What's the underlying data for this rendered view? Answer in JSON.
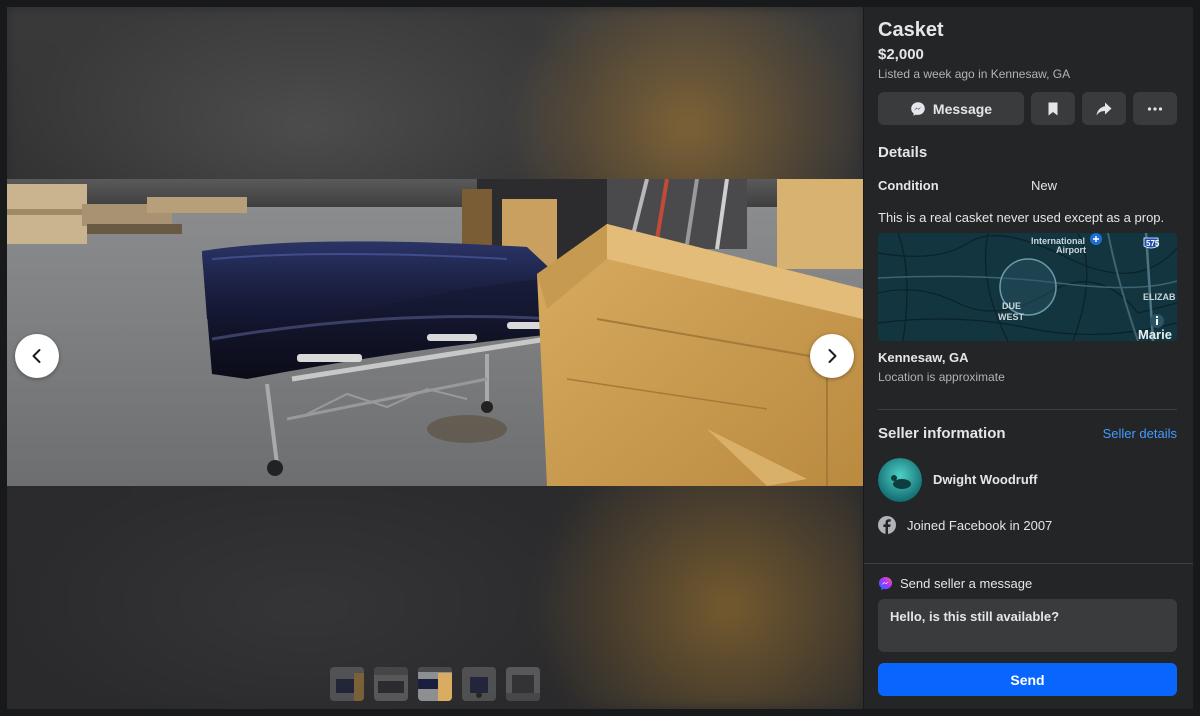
{
  "listing": {
    "title": "Casket",
    "price": "$2,000",
    "listed": "Listed a week ago in Kennesaw, GA"
  },
  "actions": {
    "message_label": "Message",
    "save_icon": "bookmark-icon",
    "share_icon": "share-icon",
    "more_icon": "more-icon"
  },
  "details": {
    "heading": "Details",
    "condition_label": "Condition",
    "condition_value": "New",
    "description": "This is a real casket never used except as a prop."
  },
  "map": {
    "labels": [
      "International",
      "Airport",
      "575",
      "DUE",
      "WEST",
      "ELIZAB",
      "Marie"
    ]
  },
  "location": {
    "name": "Kennesaw, GA",
    "note": "Location is approximate"
  },
  "seller": {
    "heading": "Seller information",
    "details_link": "Seller details",
    "name": "Dwight Woodruff",
    "joined": "Joined Facebook in 2007"
  },
  "message": {
    "heading": "Send seller a message",
    "default_text": "Hello, is this still available?",
    "send_label": "Send"
  },
  "gallery": {
    "thumbnail_count": 5,
    "active_index": 2
  },
  "colors": {
    "accent": "#0866ff",
    "link": "#4599ff",
    "panel_bg": "#242526",
    "page_bg": "#18191a"
  }
}
